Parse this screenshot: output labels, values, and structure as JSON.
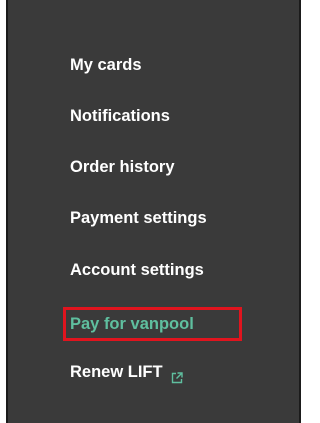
{
  "menu": {
    "items": [
      {
        "label": "My cards"
      },
      {
        "label": "Notifications"
      },
      {
        "label": "Order history"
      },
      {
        "label": "Payment settings"
      },
      {
        "label": "Account settings"
      },
      {
        "label": "Pay for vanpool",
        "active": true
      },
      {
        "label": "Renew LIFT",
        "icon": "external-link-icon"
      }
    ]
  },
  "colors": {
    "panel_background": "#3a3a3a",
    "text": "#ffffff",
    "active_text": "#5fbf9f",
    "highlight_border": "#e0141e"
  }
}
